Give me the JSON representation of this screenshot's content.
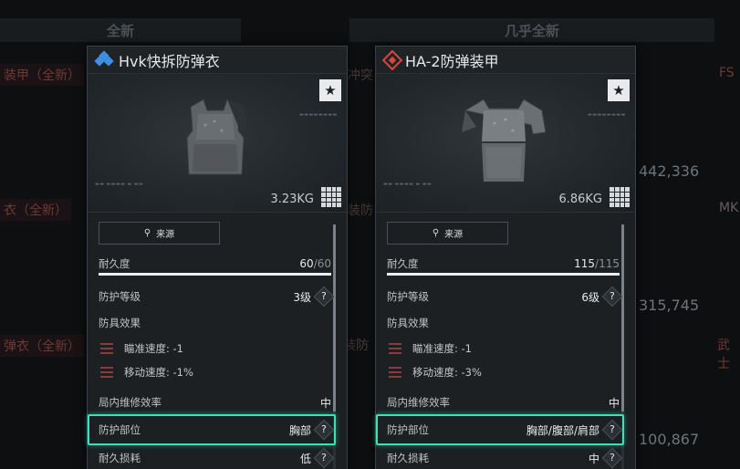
{
  "background": {
    "header_left": "全新",
    "header_right": "几乎全新",
    "labels": [
      "装甲（全新）",
      "衣（全新）",
      "弹衣（全新）"
    ],
    "fragments": [
      "冲突",
      "装防",
      "装防",
      "FS",
      "MK",
      "武士"
    ],
    "prices": [
      "442,336",
      "315,745",
      "100,867"
    ]
  },
  "cards": [
    {
      "title": "Hvk快拆防弹衣",
      "weight": "3.23KG",
      "source_label": "来源",
      "durability_label": "耐久度",
      "durability_current": "60",
      "durability_max": "/60",
      "durability_fraction": 1.0,
      "protection_level_label": "防护等级",
      "protection_level": "3级",
      "effects_label": "防具效果",
      "effects": [
        "瞄准速度: -1",
        "移动速度: -1%"
      ],
      "repair_label": "局内维修效率",
      "repair_value": "中",
      "zone_label": "防护部位",
      "zone_value": "胸部",
      "wear_label": "耐久损耗",
      "wear_value": "低"
    },
    {
      "title": "HA-2防弹装甲",
      "weight": "6.86KG",
      "source_label": "来源",
      "durability_label": "耐久度",
      "durability_current": "115",
      "durability_max": "/115",
      "durability_fraction": 1.0,
      "protection_level_label": "防护等级",
      "protection_level": "6级",
      "effects_label": "防具效果",
      "effects": [
        "瞄准速度: -1",
        "移动速度: -3%"
      ],
      "repair_label": "局内维修效率",
      "repair_value": "中",
      "zone_label": "防护部位",
      "zone_value": "胸部/腹部/肩部",
      "wear_label": "耐久损耗",
      "wear_value": "中"
    }
  ],
  "icons": {
    "favorite": "★",
    "help": "?",
    "search": "🔍"
  },
  "colors": {
    "highlight": "#3fe0b8",
    "rarity_blue": "#3f8fe0",
    "rarity_red": "#d8473e",
    "price_dim": "#6f7478"
  }
}
